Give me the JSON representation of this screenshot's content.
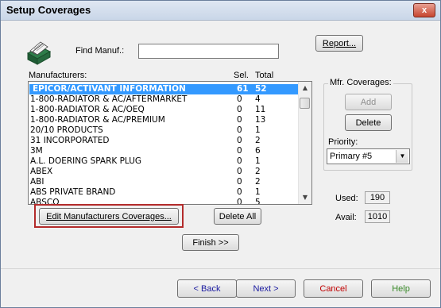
{
  "window": {
    "title": "Setup Coverages",
    "close_label": "x"
  },
  "find": {
    "label": "Find Manuf.:",
    "value": ""
  },
  "report_button": {
    "label": "Report..."
  },
  "list": {
    "headers": {
      "manufacturers": "Manufacturers:",
      "sel": "Sel.",
      "total": "Total"
    },
    "rows": [
      {
        "name": "EPICOR/ACTIVANT INFORMATION",
        "sel": "61",
        "total": "52"
      },
      {
        "name": "1-800-RADIATOR & AC/AFTERMARKET",
        "sel": "0",
        "total": "4"
      },
      {
        "name": "1-800-RADIATOR & AC/OEQ",
        "sel": "0",
        "total": "11"
      },
      {
        "name": "1-800-RADIATOR & AC/PREMIUM",
        "sel": "0",
        "total": "13"
      },
      {
        "name": "20/10 PRODUCTS",
        "sel": "0",
        "total": "1"
      },
      {
        "name": "31 INCORPORATED",
        "sel": "0",
        "total": "2"
      },
      {
        "name": "3M",
        "sel": "0",
        "total": "6"
      },
      {
        "name": "A.L. DOERING SPARK PLUG",
        "sel": "0",
        "total": "1"
      },
      {
        "name": "ABEX",
        "sel": "0",
        "total": "2"
      },
      {
        "name": "ABI",
        "sel": "0",
        "total": "2"
      },
      {
        "name": "ABS PRIVATE BRAND",
        "sel": "0",
        "total": "1"
      },
      {
        "name": "ABSCO",
        "sel": "0",
        "total": "5"
      }
    ]
  },
  "mfr_coverages": {
    "title": "Mfr. Coverages:",
    "add_label": "Add",
    "delete_label": "Delete"
  },
  "priority": {
    "label": "Priority:",
    "value": "Primary #5"
  },
  "counts": {
    "used_label": "Used:",
    "used_value": "190",
    "avail_label": "Avail:",
    "avail_value": "1010"
  },
  "buttons": {
    "edit_label": "Edit Manufacturers Coverages...",
    "delete_all_label": "Delete All",
    "finish_label": "Finish >>",
    "back_label": "< Back",
    "next_label": "Next >",
    "cancel_label": "Cancel",
    "help_label": "Help"
  },
  "colors": {
    "selection": "#3399ff",
    "highlight_border": "#b32b2b",
    "cancel_text": "#c00000",
    "help_text": "#3a8a2a",
    "nav_text": "#1a1aa0"
  }
}
